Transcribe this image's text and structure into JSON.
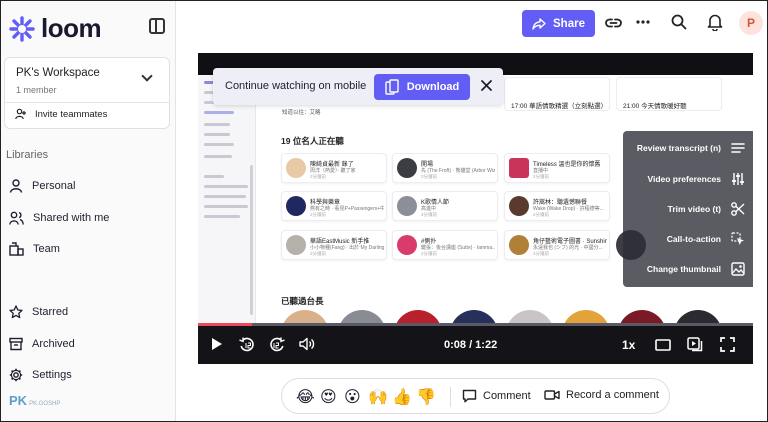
{
  "sidebar": {
    "logo_text": "loom",
    "workspace_name": "PK's Workspace",
    "workspace_members": "1 member",
    "invite_label": "Invite teammates",
    "libraries_label": "Libraries",
    "items": [
      {
        "label": "Personal",
        "icon": "person-icon"
      },
      {
        "label": "Shared with me",
        "icon": "people-icon"
      },
      {
        "label": "Team",
        "icon": "team-icon"
      },
      {
        "label": "Starred",
        "icon": "star-icon"
      },
      {
        "label": "Archived",
        "icon": "archive-icon"
      },
      {
        "label": "Settings",
        "icon": "gear-icon"
      }
    ],
    "watermark": "PK",
    "watermark_sub": "PK.GOSHP"
  },
  "header": {
    "share_label": "Share",
    "avatar_initial": "P",
    "accent_color": "#625df5"
  },
  "video": {
    "mobile_banner_text": "Continue watching on mobile",
    "download_label": "Download",
    "tools": [
      {
        "label": "Review transcript (n)",
        "icon": "transcript-icon"
      },
      {
        "label": "Video preferences",
        "icon": "sliders-icon"
      },
      {
        "label": "Trim video (t)",
        "icon": "scissors-icon"
      },
      {
        "label": "Call-to-action",
        "icon": "cursor-icon"
      },
      {
        "label": "Change thumbnail",
        "icon": "image-icon"
      }
    ],
    "time_display": "0:08 / 1:22",
    "speed_label": "1x",
    "progress_fraction": 0.098,
    "screen": {
      "top_card_1": "17:00 華語情歌精選（立刻點選）",
      "top_card_2": "21:00 今天情歌暖好聽",
      "link_text": "知道以往：艾略",
      "listen_title": "19 位名人正在聽",
      "hosts_title": "已聽過台長",
      "cards": [
        {
          "t1": "陳綺貞最新 錄了",
          "t2": "周洋（熱愛）· 聽了家",
          "t3": "2分鐘前"
        },
        {
          "t1": "開場",
          "t2": "先 (The Froft) · 熊貓堂 (Arbor Wiz)",
          "t3": "2分鐘前"
        },
        {
          "t1": "Timeless 溫也是你的懷舊",
          "t2": "直播中",
          "t3": "2分鐘前"
        },
        {
          "t1": "科學與樂章",
          "t2": "燕有之時 · 看見P+Passengers+中國...",
          "t3": "2分鐘前"
        },
        {
          "t1": "K歌情人節",
          "t2": "高進中",
          "t3": "2分鐘前"
        },
        {
          "t1": "許嵩林：聽遺憾聯餐",
          "t2": "Wake (Wake Drop) · 許程德等...",
          "t3": "2分鐘前"
        },
        {
          "t1": "華語EastMusic 新手推",
          "t2": "小小物種(Fang) · 出於 My Darling...",
          "t3": "2分鐘前"
        },
        {
          "t1": "#側扑",
          "t2": "鍵張：後台講座 (Sutte) · Iamma...",
          "t3": "2分鐘前"
        },
        {
          "t1": "角仔藝術電子圖書 · Sunshine",
          "t2": "永遠我也 (シフ) 的光 · 中國分...",
          "t3": "2分鐘前"
        }
      ]
    }
  },
  "reactions": {
    "emojis": [
      "😂",
      "😍",
      "😮",
      "🙌",
      "👍",
      "👎"
    ],
    "comment_label": "Comment",
    "record_label": "Record a comment"
  }
}
